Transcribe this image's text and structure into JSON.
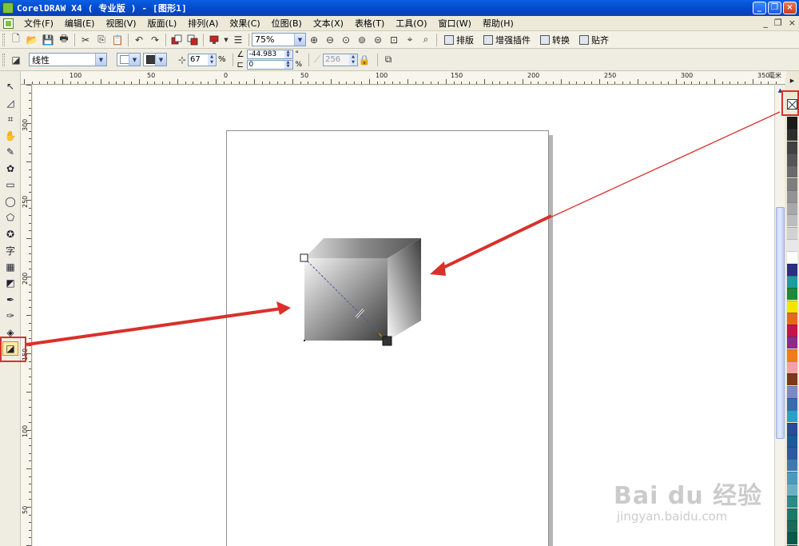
{
  "window": {
    "title": "CorelDRAW X4 ( 专业版 ) - [图形1]",
    "controls": [
      "_",
      "❐",
      "×"
    ]
  },
  "menu": {
    "items": [
      "文件(F)",
      "编辑(E)",
      "视图(V)",
      "版面(L)",
      "排列(A)",
      "效果(C)",
      "位图(B)",
      "文本(X)",
      "表格(T)",
      "工具(O)",
      "窗口(W)",
      "帮助(H)"
    ],
    "right_controls": [
      "_",
      "❐",
      "×"
    ]
  },
  "standard_toolbar": {
    "zoom": "75%",
    "buttons": [
      {
        "name": "new-icon",
        "glyph": "🗋"
      },
      {
        "name": "open-icon",
        "glyph": "📂"
      },
      {
        "name": "save-icon",
        "glyph": "💾"
      },
      {
        "name": "print-icon",
        "glyph": "🖶"
      },
      {
        "name": "cut-icon",
        "glyph": "✂"
      },
      {
        "name": "copy-icon",
        "glyph": "⎘"
      },
      {
        "name": "paste-icon",
        "glyph": "📋"
      },
      {
        "name": "undo-icon",
        "glyph": "↶"
      },
      {
        "name": "redo-icon",
        "glyph": "↷"
      }
    ],
    "text_buttons": [
      "排版",
      "增强插件",
      "转换",
      "贴齐"
    ]
  },
  "property_bar": {
    "fill_type": "线性",
    "midpoint": "67",
    "midpoint_unit": "%",
    "angle": "-44.983",
    "angle_unit": "°",
    "edge_pad": "0",
    "edge_pad_unit": "%",
    "steps": "256"
  },
  "ruler": {
    "unit": "毫米",
    "h_labels": [
      "100",
      "50",
      "0",
      "50",
      "100",
      "150",
      "200",
      "250",
      "300",
      "350"
    ],
    "v_labels": [
      "300",
      "250",
      "200",
      "150",
      "100",
      "50"
    ]
  },
  "toolbox": {
    "tools": [
      {
        "name": "pick-tool-icon",
        "glyph": "↖"
      },
      {
        "name": "shape-tool-icon",
        "glyph": "◿"
      },
      {
        "name": "crop-tool-icon",
        "glyph": "⌗"
      },
      {
        "name": "zoom-tool-icon",
        "glyph": "✋"
      },
      {
        "name": "freehand-tool-icon",
        "glyph": "✎"
      },
      {
        "name": "smart-fill-tool-icon",
        "glyph": "✿"
      },
      {
        "name": "rectangle-tool-icon",
        "glyph": "▭"
      },
      {
        "name": "ellipse-tool-icon",
        "glyph": "◯"
      },
      {
        "name": "polygon-tool-icon",
        "glyph": "⬠"
      },
      {
        "name": "basic-shapes-tool-icon",
        "glyph": "✪"
      },
      {
        "name": "text-tool-icon",
        "glyph": "字"
      },
      {
        "name": "table-tool-icon",
        "glyph": "▦"
      },
      {
        "name": "interactive-effects-tool-icon",
        "glyph": "◩"
      },
      {
        "name": "eyedropper-tool-icon",
        "glyph": "✒"
      },
      {
        "name": "outline-tool-icon",
        "glyph": "✑"
      },
      {
        "name": "fill-tool-icon",
        "glyph": "◈"
      },
      {
        "name": "interactive-fill-tool-icon",
        "glyph": "◪"
      }
    ]
  },
  "palette": {
    "colors": [
      "#1a1a1a",
      "#2e2e2e",
      "#414141",
      "#555555",
      "#6a6a6a",
      "#7e7e7e",
      "#939393",
      "#a8a8a8",
      "#bdbdbd",
      "#d2d2d2",
      "#e8e8e8",
      "#ffffff",
      "#2a2f86",
      "#1e9aa0",
      "#1a8a3c",
      "#f4e400",
      "#e36a1a",
      "#c3134b",
      "#8a2a8a",
      "#f07c1a",
      "#f3a0a8",
      "#7a3a1a",
      "#7b8ac6",
      "#3a6ab0",
      "#29a0cc",
      "#2a4a9a",
      "#1a5a9a",
      "#2a5aa0",
      "#3a7ab0",
      "#4a9ac0",
      "#6ab0c8",
      "#2a8a8a",
      "#1a7a6a",
      "#1a6a5a",
      "#0a5a4a",
      "#0a4a4a"
    ]
  },
  "watermark": {
    "logo": "Bai du 经验",
    "sub": "jingyan.baidu.com"
  }
}
